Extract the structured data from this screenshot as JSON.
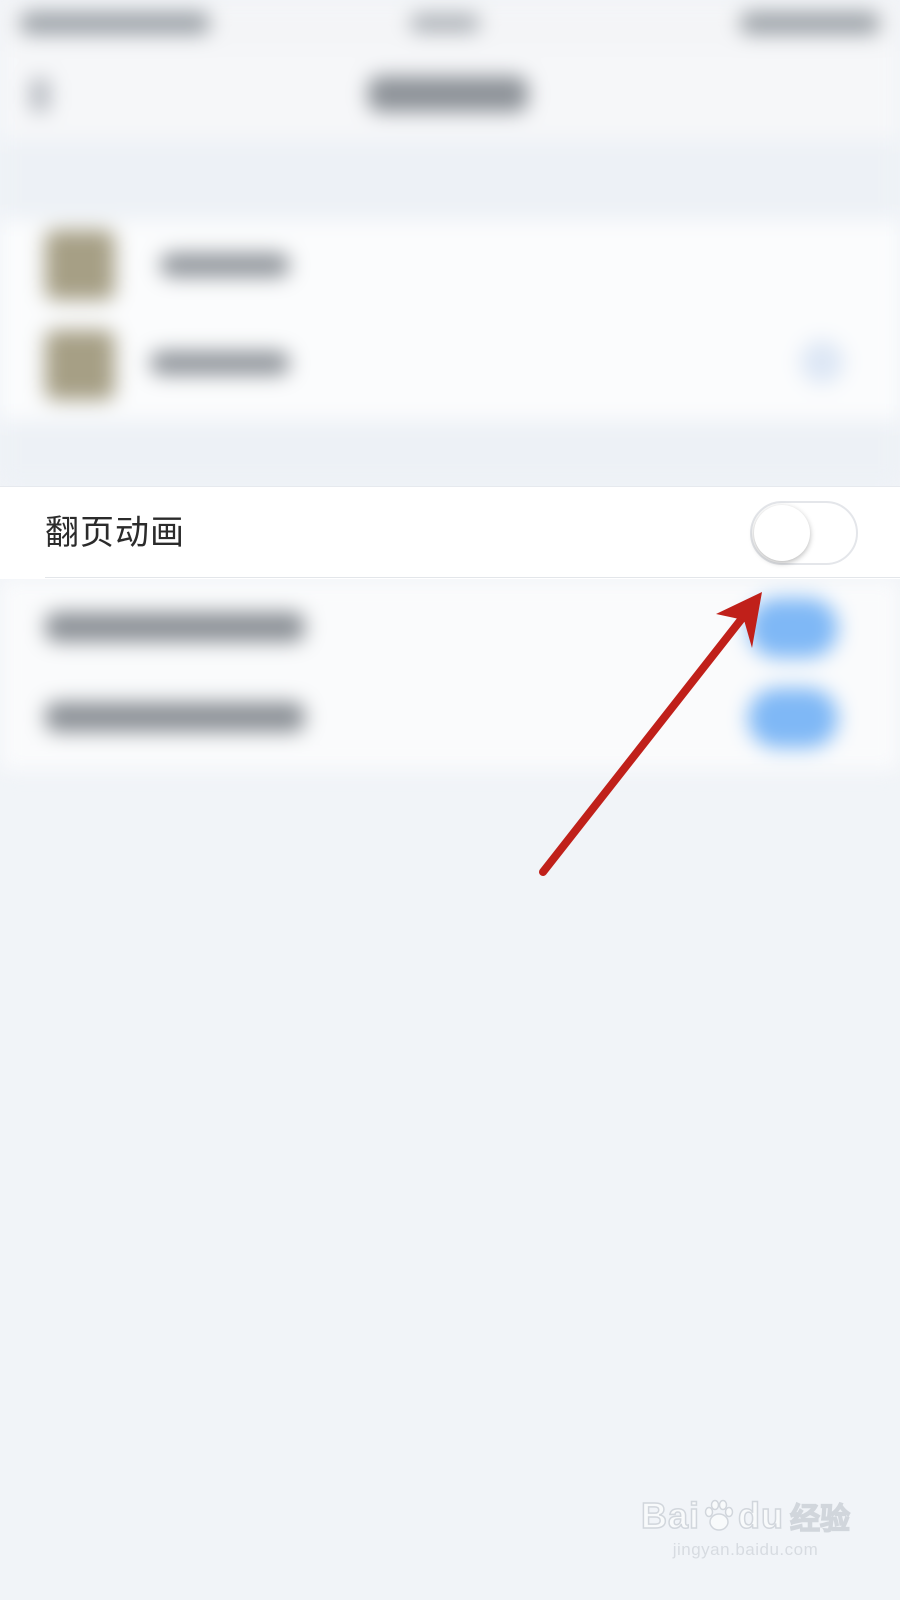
{
  "setting": {
    "label": "翻页动画",
    "toggle_state": "off"
  },
  "watermark": {
    "brand_left": "Bai",
    "brand_right": "du",
    "brand_cn": "经验",
    "url": "jingyan.baidu.com"
  },
  "colors": {
    "page_background": "#f1f4f8",
    "row_background": "#ffffff",
    "toggle_off_border": "#e4e6ea",
    "blurred_toggle_on": "#7fb8f6",
    "annotation_arrow": "#c0201a"
  }
}
